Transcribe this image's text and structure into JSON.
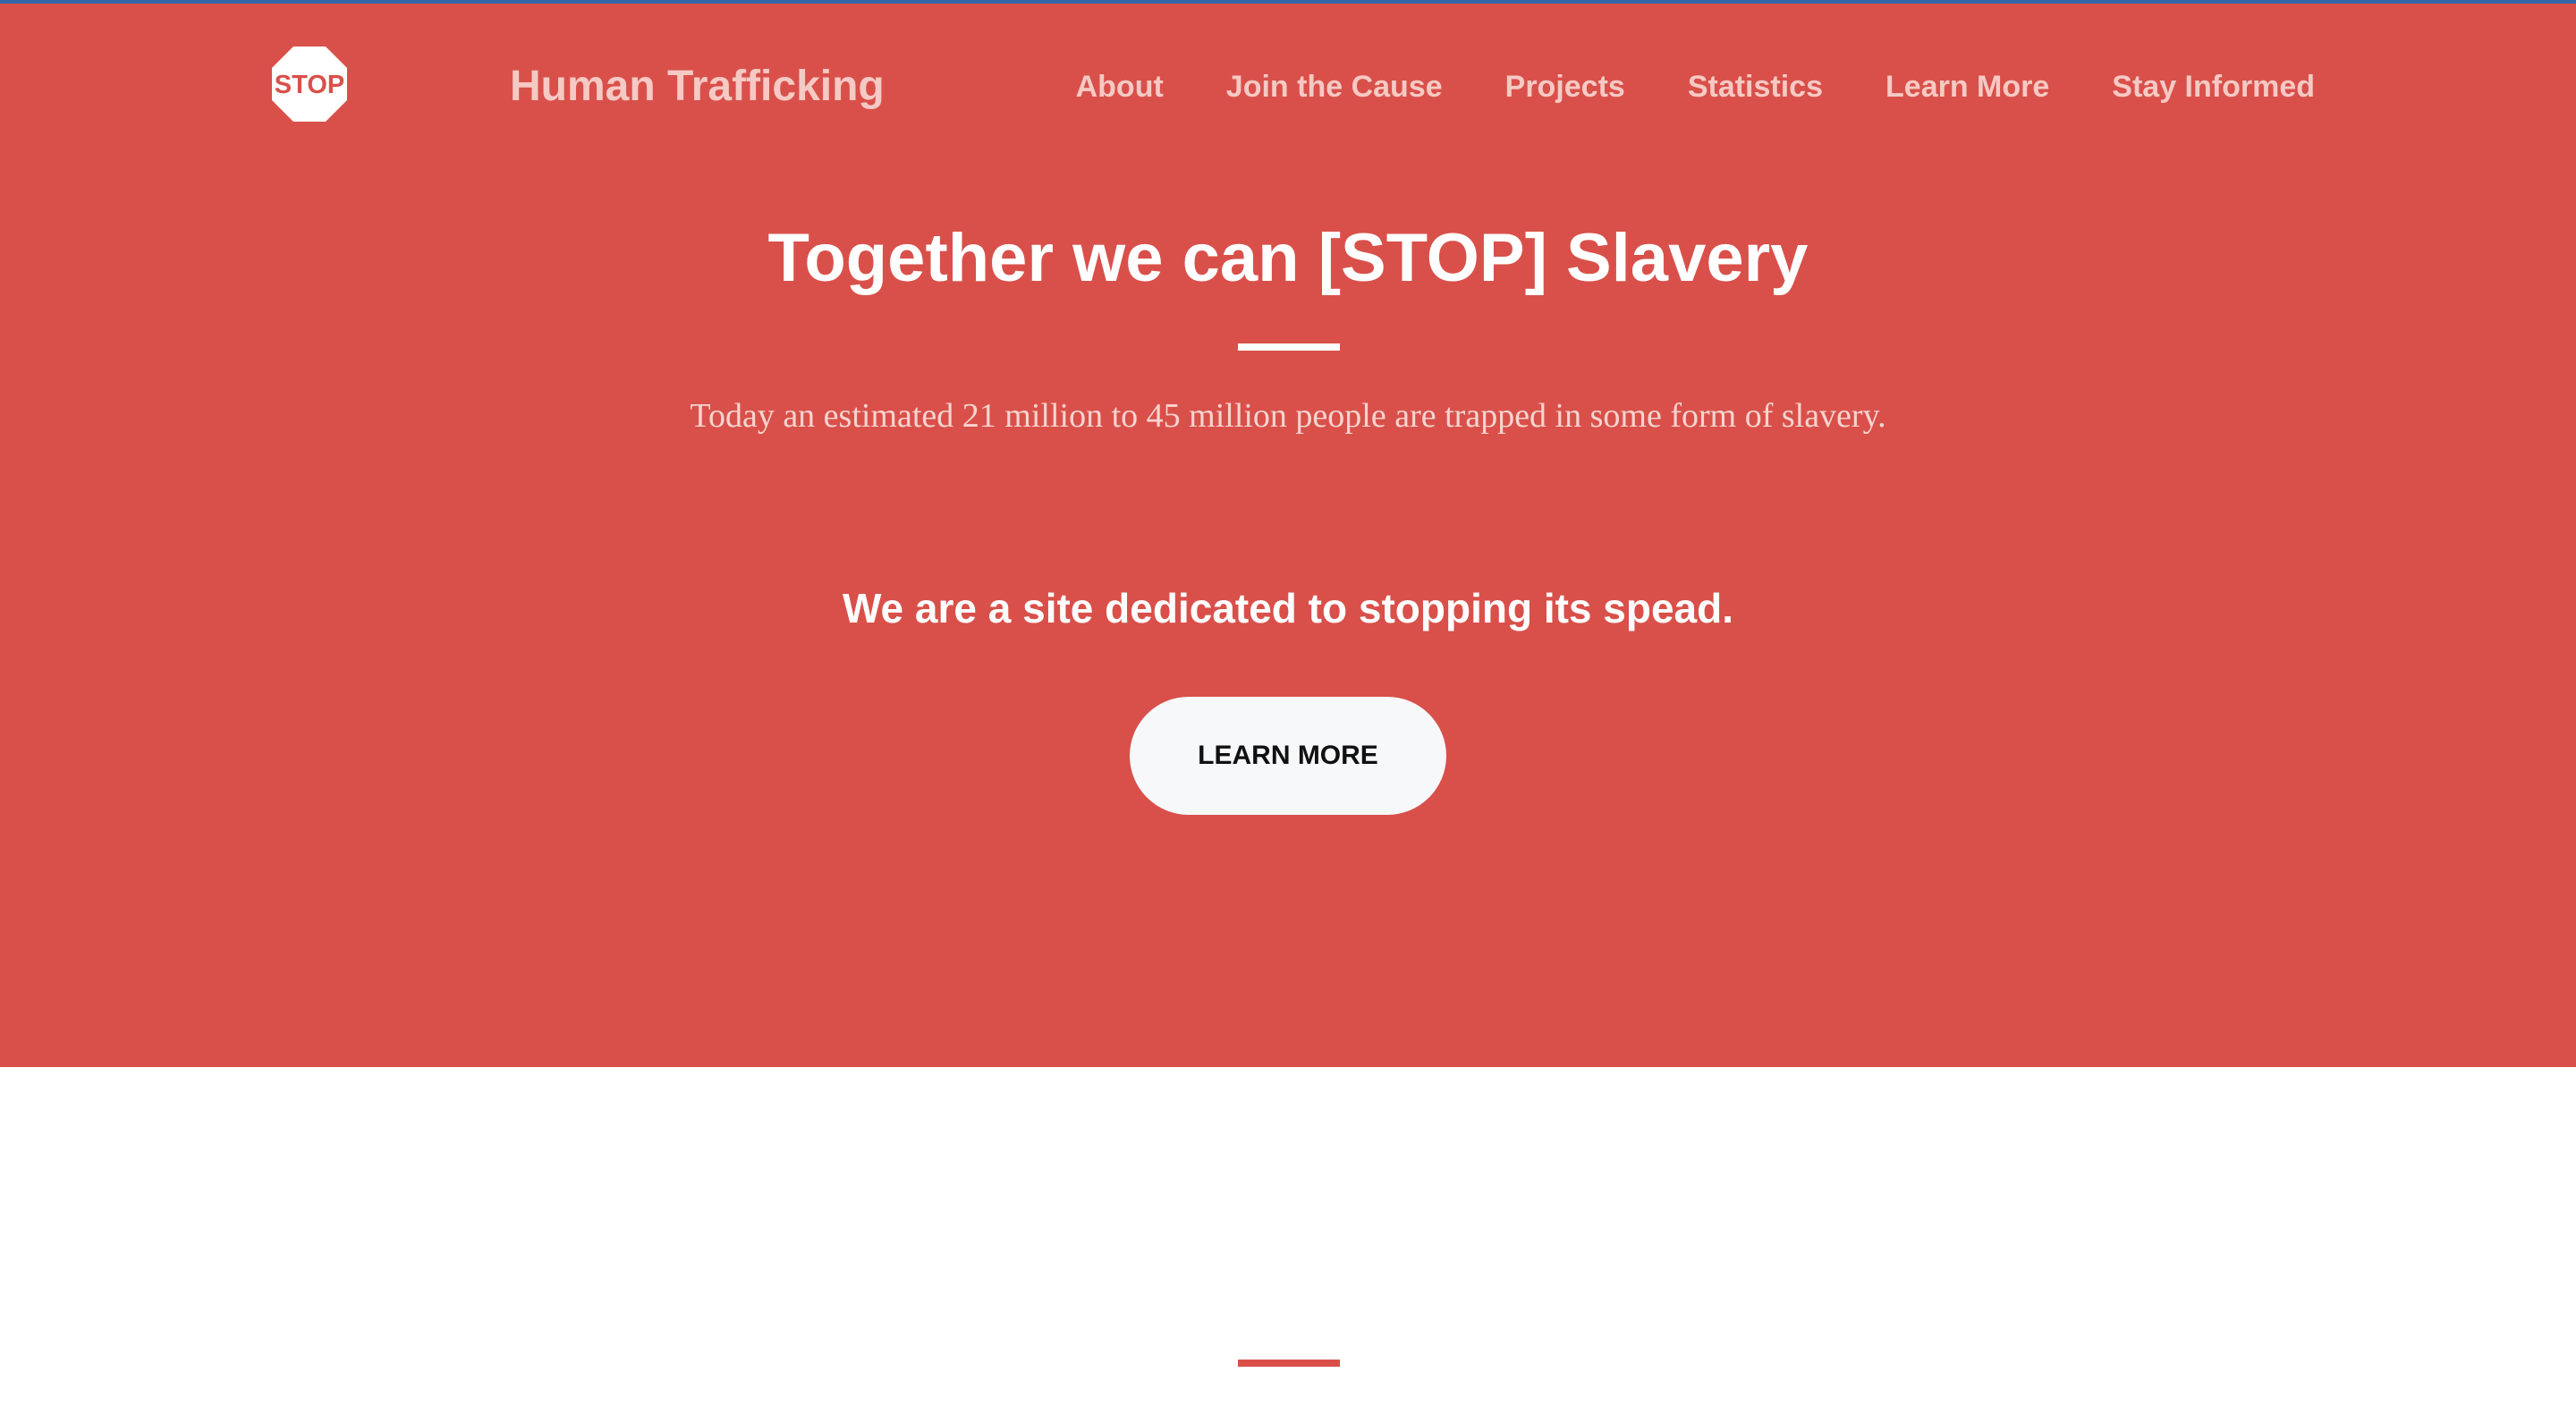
{
  "colors": {
    "hero_background": "#d9504a",
    "nav_text": "#f6c9c4",
    "button_background": "#f7f8fa",
    "top_accent_line": "#3567a6"
  },
  "navbar": {
    "logo": {
      "icon": "stop-sign-icon",
      "text": "STOP"
    },
    "brand": "Human Trafficking",
    "links": [
      {
        "label": "About"
      },
      {
        "label": "Join the Cause"
      },
      {
        "label": "Projects"
      },
      {
        "label": "Statistics"
      },
      {
        "label": "Learn More"
      },
      {
        "label": "Stay Informed"
      }
    ]
  },
  "hero": {
    "title": "Together we can [STOP] Slavery",
    "subtitle": "Today an estimated 21 million to 45 million people are trapped in some form of slavery.",
    "tagline": "We are a site dedicated to stopping its spead.",
    "button_label": "Learn More"
  }
}
